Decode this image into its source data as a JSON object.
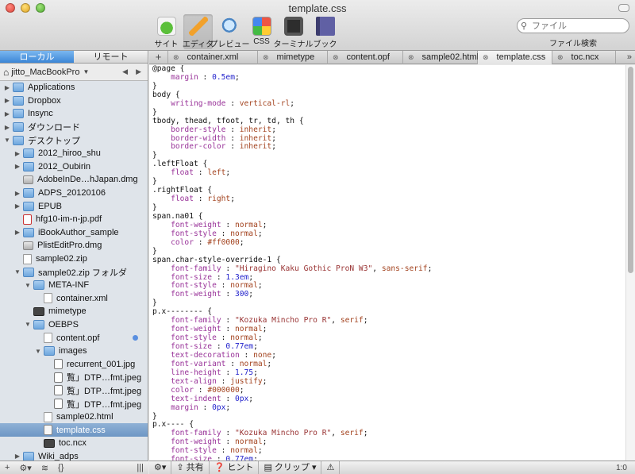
{
  "window": {
    "title": "template.css"
  },
  "toolbar": {
    "buttons": [
      {
        "label": "サイト",
        "icon": "site-leaf-icon"
      },
      {
        "label": "エディタ",
        "icon": "pencil-icon",
        "active": true
      },
      {
        "label": "プレビュー",
        "icon": "magnifier-icon"
      },
      {
        "label": "CSS",
        "icon": "css-palette-icon"
      },
      {
        "label": "ターミナル",
        "icon": "terminal-icon"
      },
      {
        "label": "ブック",
        "icon": "book-icon"
      }
    ],
    "search_placeholder": "ファイル",
    "search_label": "ファイル検索"
  },
  "sidebar": {
    "tabs": [
      {
        "label": "ローカル",
        "active": true
      },
      {
        "label": "リモート"
      }
    ],
    "location": "jitto_MacBookPro",
    "nav_back": "◀",
    "nav_forward": "▶",
    "items": [
      {
        "label": "Applications",
        "type": "folder",
        "level": 0,
        "disclosure": "▶"
      },
      {
        "label": "Dropbox",
        "type": "folder",
        "level": 0,
        "disclosure": "▶"
      },
      {
        "label": "Insync",
        "type": "folder",
        "level": 0,
        "disclosure": "▶"
      },
      {
        "label": "ダウンロード",
        "type": "folder",
        "level": 0,
        "disclosure": "▶"
      },
      {
        "label": "デスクトップ",
        "type": "folder",
        "level": 0,
        "disclosure": "▼"
      },
      {
        "label": "2012_hiroo_shu",
        "type": "folder",
        "level": 1,
        "disclosure": "▶"
      },
      {
        "label": "2012_Oubirin",
        "type": "folder",
        "level": 1,
        "disclosure": "▶"
      },
      {
        "label": "AdobeInDe…hJapan.dmg",
        "type": "dmg",
        "level": 1,
        "disclosure": ""
      },
      {
        "label": "ADPS_20120106",
        "type": "folder",
        "level": 1,
        "disclosure": "▶"
      },
      {
        "label": "EPUB",
        "type": "folder",
        "level": 1,
        "disclosure": "▶"
      },
      {
        "label": "hfg10-im-n-jp.pdf",
        "type": "pdf",
        "level": 1,
        "disclosure": ""
      },
      {
        "label": "iBookAuthor_sample",
        "type": "folder",
        "level": 1,
        "disclosure": "▶"
      },
      {
        "label": "PlistEditPro.dmg",
        "type": "dmg",
        "level": 1,
        "disclosure": ""
      },
      {
        "label": "sample02.zip",
        "type": "doc",
        "level": 1,
        "disclosure": ""
      },
      {
        "label": "sample02.zip フォルダ",
        "type": "folder",
        "level": 1,
        "disclosure": "▼"
      },
      {
        "label": "META-INF",
        "type": "folder",
        "level": 2,
        "disclosure": "▼"
      },
      {
        "label": "container.xml",
        "type": "doc",
        "level": 3,
        "disclosure": ""
      },
      {
        "label": "mimetype",
        "type": "dark",
        "level": 2,
        "disclosure": ""
      },
      {
        "label": "OEBPS",
        "type": "folder",
        "level": 2,
        "disclosure": "▼"
      },
      {
        "label": "content.opf",
        "type": "doc",
        "level": 3,
        "disclosure": "",
        "dot": true
      },
      {
        "label": "images",
        "type": "folder",
        "level": 3,
        "disclosure": "▼"
      },
      {
        "label": "recurrent_001.jpg",
        "type": "img",
        "level": 4,
        "disclosure": ""
      },
      {
        "label": "覧」DTP…fmt.jpeg",
        "type": "img",
        "level": 4,
        "disclosure": ""
      },
      {
        "label": "覧」DTP…fmt.jpeg",
        "type": "img",
        "level": 4,
        "disclosure": ""
      },
      {
        "label": "覧」DTP…fmt.jpeg",
        "type": "img",
        "level": 4,
        "disclosure": ""
      },
      {
        "label": "sample02.html",
        "type": "doc",
        "level": 3,
        "disclosure": ""
      },
      {
        "label": "template.css",
        "type": "css-doc",
        "level": 3,
        "disclosure": "",
        "selected": true
      },
      {
        "label": "toc.ncx",
        "type": "dark",
        "level": 3,
        "disclosure": ""
      },
      {
        "label": "Wiki_adps",
        "type": "folder",
        "level": 1,
        "disclosure": "▶"
      }
    ],
    "footer": {
      "add": "+",
      "gear": "⚙▾",
      "wifi": "≋",
      "brace": "{}",
      "grip": "|||"
    }
  },
  "tabs": {
    "add": "+",
    "files": [
      {
        "label": "container.xml",
        "width": 113
      },
      {
        "label": "mimetype",
        "width": 88
      },
      {
        "label": "content.opf",
        "width": 95
      },
      {
        "label": "sample02.html",
        "width": 94
      },
      {
        "label": "template.css",
        "width": 94,
        "active": true
      },
      {
        "label": "toc.ncx",
        "width": 80
      }
    ],
    "more": "»"
  },
  "editor": {
    "lines": [
      [
        [
          "",
          "@page {"
        ]
      ],
      [
        [
          "prop",
          "    margin"
        ],
        [
          "",
          " : "
        ],
        [
          "num",
          "0.5em"
        ],
        [
          "",
          ";"
        ]
      ],
      [
        [
          "",
          "}"
        ]
      ],
      [
        [
          "",
          "body {"
        ]
      ],
      [
        [
          "prop",
          "    writing-mode"
        ],
        [
          "",
          " : "
        ],
        [
          "val",
          "vertical-rl"
        ],
        [
          "",
          ";"
        ]
      ],
      [
        [
          "",
          "}"
        ]
      ],
      [
        [
          "",
          "tbody, thead, tfoot, tr, td, th {"
        ]
      ],
      [
        [
          "prop",
          "    border-style"
        ],
        [
          "",
          " : "
        ],
        [
          "val",
          "inherit"
        ],
        [
          "",
          ";"
        ]
      ],
      [
        [
          "prop",
          "    border-width"
        ],
        [
          "",
          " : "
        ],
        [
          "val",
          "inherit"
        ],
        [
          "",
          ";"
        ]
      ],
      [
        [
          "prop",
          "    border-color"
        ],
        [
          "",
          " : "
        ],
        [
          "val",
          "inherit"
        ],
        [
          "",
          ";"
        ]
      ],
      [
        [
          "",
          "}"
        ]
      ],
      [
        [
          "",
          ".leftFloat {"
        ]
      ],
      [
        [
          "prop",
          "    float"
        ],
        [
          "",
          " : "
        ],
        [
          "val",
          "left"
        ],
        [
          "",
          ";"
        ]
      ],
      [
        [
          "",
          "}"
        ]
      ],
      [
        [
          "",
          ".rightFloat {"
        ]
      ],
      [
        [
          "prop",
          "    float"
        ],
        [
          "",
          " : "
        ],
        [
          "val",
          "right"
        ],
        [
          "",
          ";"
        ]
      ],
      [
        [
          "",
          "}"
        ]
      ],
      [
        [
          "",
          "span.na01 {"
        ]
      ],
      [
        [
          "prop",
          "    font-weight"
        ],
        [
          "",
          " : "
        ],
        [
          "val",
          "normal"
        ],
        [
          "",
          ";"
        ]
      ],
      [
        [
          "prop",
          "    font-style"
        ],
        [
          "",
          " : "
        ],
        [
          "val",
          "normal"
        ],
        [
          "",
          ";"
        ]
      ],
      [
        [
          "prop",
          "    color"
        ],
        [
          "",
          " : "
        ],
        [
          "val",
          "#ff0000"
        ],
        [
          "",
          ";"
        ]
      ],
      [
        [
          "",
          "}"
        ]
      ],
      [
        [
          "",
          "span.char-style-override-1 {"
        ]
      ],
      [
        [
          "prop",
          "    font-family"
        ],
        [
          "",
          " : "
        ],
        [
          "str",
          "\"Hiragino Kaku Gothic ProN W3\""
        ],
        [
          "",
          ", "
        ],
        [
          "val",
          "sans-serif"
        ],
        [
          "",
          ";"
        ]
      ],
      [
        [
          "prop",
          "    font-size"
        ],
        [
          "",
          " : "
        ],
        [
          "num",
          "1.3em"
        ],
        [
          "",
          ";"
        ]
      ],
      [
        [
          "prop",
          "    font-style"
        ],
        [
          "",
          " : "
        ],
        [
          "val",
          "normal"
        ],
        [
          "",
          ";"
        ]
      ],
      [
        [
          "prop",
          "    font-weight"
        ],
        [
          "",
          " : "
        ],
        [
          "num",
          "300"
        ],
        [
          "",
          ";"
        ]
      ],
      [
        [
          "",
          "}"
        ]
      ],
      [
        [
          "",
          "p.x-------- {"
        ]
      ],
      [
        [
          "prop",
          "    font-family"
        ],
        [
          "",
          " : "
        ],
        [
          "str",
          "\"Kozuka Mincho Pro R\""
        ],
        [
          "",
          ", "
        ],
        [
          "val",
          "serif"
        ],
        [
          "",
          ";"
        ]
      ],
      [
        [
          "prop",
          "    font-weight"
        ],
        [
          "",
          " : "
        ],
        [
          "val",
          "normal"
        ],
        [
          "",
          ";"
        ]
      ],
      [
        [
          "prop",
          "    font-style"
        ],
        [
          "",
          " : "
        ],
        [
          "val",
          "normal"
        ],
        [
          "",
          ";"
        ]
      ],
      [
        [
          "prop",
          "    font-size"
        ],
        [
          "",
          " : "
        ],
        [
          "num",
          "0.77em"
        ],
        [
          "",
          ";"
        ]
      ],
      [
        [
          "prop",
          "    text-decoration"
        ],
        [
          "",
          " : "
        ],
        [
          "val",
          "none"
        ],
        [
          "",
          ";"
        ]
      ],
      [
        [
          "prop",
          "    font-variant"
        ],
        [
          "",
          " : "
        ],
        [
          "val",
          "normal"
        ],
        [
          "",
          ";"
        ]
      ],
      [
        [
          "prop",
          "    line-height"
        ],
        [
          "",
          " : "
        ],
        [
          "num",
          "1.75"
        ],
        [
          "",
          ";"
        ]
      ],
      [
        [
          "prop",
          "    text-align"
        ],
        [
          "",
          " : "
        ],
        [
          "val",
          "justify"
        ],
        [
          "",
          ";"
        ]
      ],
      [
        [
          "prop",
          "    color"
        ],
        [
          "",
          " : "
        ],
        [
          "val",
          "#000000"
        ],
        [
          "",
          ";"
        ]
      ],
      [
        [
          "prop",
          "    text-indent"
        ],
        [
          "",
          " : "
        ],
        [
          "num",
          "0px"
        ],
        [
          "",
          ";"
        ]
      ],
      [
        [
          "prop",
          "    margin"
        ],
        [
          "",
          " : "
        ],
        [
          "num",
          "0px"
        ],
        [
          "",
          ";"
        ]
      ],
      [
        [
          "",
          "}"
        ]
      ],
      [
        [
          "",
          "p.x---- {"
        ]
      ],
      [
        [
          "prop",
          "    font-family"
        ],
        [
          "",
          " : "
        ],
        [
          "str",
          "\"Kozuka Mincho Pro R\""
        ],
        [
          "",
          ", "
        ],
        [
          "val",
          "serif"
        ],
        [
          "",
          ";"
        ]
      ],
      [
        [
          "prop",
          "    font-weight"
        ],
        [
          "",
          " : "
        ],
        [
          "val",
          "normal"
        ],
        [
          "",
          ";"
        ]
      ],
      [
        [
          "prop",
          "    font-style"
        ],
        [
          "",
          " : "
        ],
        [
          "val",
          "normal"
        ],
        [
          "",
          ";"
        ]
      ],
      [
        [
          "prop",
          "    font-size"
        ],
        [
          "",
          " : "
        ],
        [
          "num",
          "0.77em"
        ],
        [
          "",
          ";"
        ]
      ]
    ]
  },
  "editor_footer": {
    "gear": "⚙▾",
    "share_label": "共有",
    "hint_label": "ヒント",
    "clip_label": "クリップ",
    "warn": "⚠",
    "position": "1:0"
  }
}
